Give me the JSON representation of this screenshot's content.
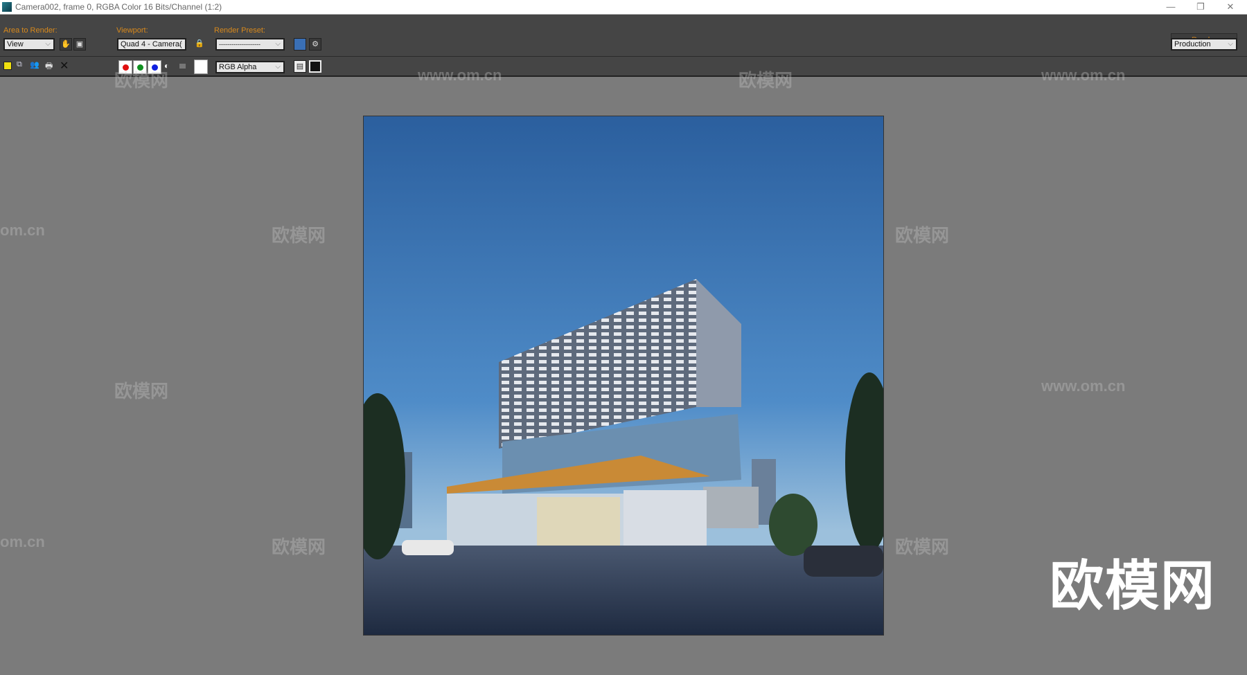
{
  "window": {
    "title": "Camera002, frame 0, RGBA Color 16 Bits/Channel (1:2)",
    "minimize": "—",
    "restore": "❐",
    "close": "✕"
  },
  "toolbar": {
    "area_label": "Area to Render:",
    "area_value": "View",
    "viewport_label": "Viewport:",
    "viewport_value": "Quad 4 - Camera(",
    "preset_label": "Render Preset:",
    "preset_value": "--------------------",
    "render_button": "Render",
    "mode_value": "Production"
  },
  "toolbar2": {
    "channel_value": "RGB Alpha",
    "channel_colors": {
      "red": "#e01010",
      "green": "#109020",
      "blue": "#1020e0"
    }
  },
  "watermarks": {
    "url": "www.om.cn",
    "cn": "欧模网",
    "big": "欧模网"
  },
  "colors": {
    "accent": "#d8891c",
    "toolbar": "#454545",
    "background": "#7b7b7b"
  }
}
